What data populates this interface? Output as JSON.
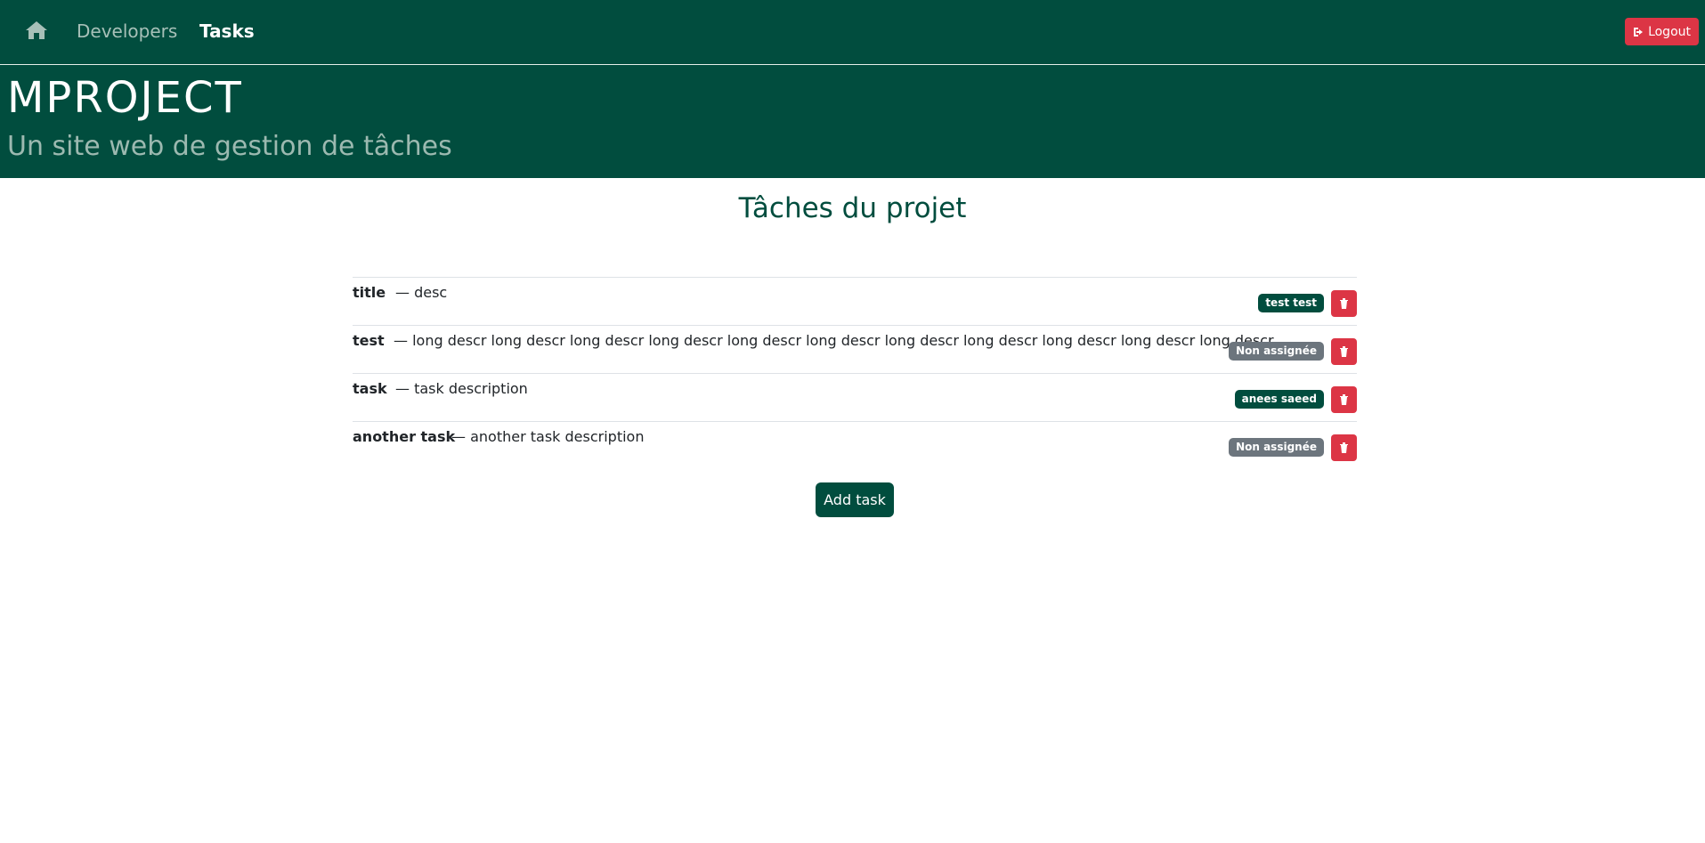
{
  "nav": {
    "home_icon": "home-icon",
    "links": [
      "Developers",
      "Tasks"
    ],
    "logout_label": "Logout",
    "logout_icon": "logout-icon"
  },
  "hero": {
    "title": "MPROJECT",
    "subtitle": "Un site web de gestion de tâches"
  },
  "main": {
    "title": "Tâches du projet",
    "tasks": [
      {
        "title": "title",
        "desc": "— desc",
        "assignee": "test test",
        "status_color": "#014d3e"
      },
      {
        "title": "test",
        "desc": "— long descr long descr long descr long descr long descr long descr long descr long descr long descr long descr long descr",
        "assignee": "Non assignée",
        "status_color": "#6c757d"
      },
      {
        "title": "task",
        "desc": "— task description",
        "assignee": "anees saeed",
        "status_color": "#014d3e"
      },
      {
        "title": "another task",
        "desc": "— another task description",
        "assignee": "Non assignée",
        "status_color": "#6c757d"
      }
    ],
    "add_button": "Add task"
  },
  "colors": {
    "brand": "#014d3e",
    "danger": "#dc3545",
    "muted": "#6c757d"
  }
}
